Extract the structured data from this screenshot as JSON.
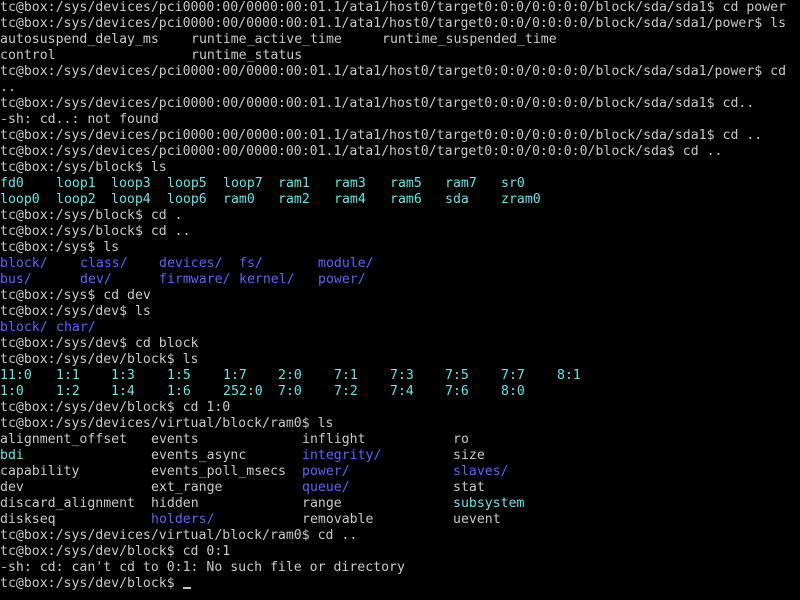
{
  "terminal": {
    "colors": {
      "background": "#000000",
      "text": "#c8c8c8",
      "directory": "#6060ff",
      "device": "#5ee8e8",
      "bold": "#ffffff"
    },
    "lines": [
      {
        "type": "text",
        "text": "tc@box:/sys/devices/pci0000:00/0000:00:01.1/ata1/host0/target0:0:0/0:0:0:0/block/sda/sda1$ cd power"
      },
      {
        "type": "text",
        "text": "tc@box:/sys/devices/pci0000:00/0000:00:01.1/ata1/host0/target0:0:0/0:0:0:0/block/sda/sda1/power$ ls"
      },
      {
        "type": "cols",
        "items": [
          {
            "text": "autosuspend_delay_ms",
            "color": "file"
          },
          {
            "text": "runtime_active_time",
            "color": "file"
          },
          {
            "text": "runtime_suspended_time",
            "color": "file"
          }
        ],
        "cols": [
          0,
          24,
          48
        ]
      },
      {
        "type": "cols",
        "items": [
          {
            "text": "control",
            "color": "file"
          },
          {
            "text": "runtime_status",
            "color": "file"
          }
        ],
        "cols": [
          0,
          24
        ]
      },
      {
        "type": "text",
        "text": "tc@box:/sys/devices/pci0000:00/0000:00:01.1/ata1/host0/target0:0:0/0:0:0:0/block/sda/sda1/power$ cd"
      },
      {
        "type": "text",
        "text": ".."
      },
      {
        "type": "text",
        "text": "tc@box:/sys/devices/pci0000:00/0000:00:01.1/ata1/host0/target0:0:0/0:0:0:0/block/sda/sda1$ cd.."
      },
      {
        "type": "text",
        "text": "-sh: cd..: not found"
      },
      {
        "type": "text",
        "text": "tc@box:/sys/devices/pci0000:00/0000:00:01.1/ata1/host0/target0:0:0/0:0:0:0/block/sda/sda1$ cd .."
      },
      {
        "type": "text",
        "text": "tc@box:/sys/devices/pci0000:00/0000:00:01.1/ata1/host0/target0:0:0/0:0:0:0/block/sda$ cd .."
      },
      {
        "type": "text",
        "text": "tc@box:/sys/block$ ls"
      },
      {
        "type": "cols",
        "items": [
          {
            "text": "fd0",
            "color": "cyan"
          },
          {
            "text": "loop1",
            "color": "cyan"
          },
          {
            "text": "loop3",
            "color": "cyan"
          },
          {
            "text": "loop5",
            "color": "cyan"
          },
          {
            "text": "loop7",
            "color": "cyan"
          },
          {
            "text": "ram1",
            "color": "cyan"
          },
          {
            "text": "ram3",
            "color": "cyan"
          },
          {
            "text": "ram5",
            "color": "cyan"
          },
          {
            "text": "ram7",
            "color": "cyan"
          },
          {
            "text": "sr0",
            "color": "cyan"
          }
        ],
        "cols": [
          0,
          7,
          14,
          21,
          28,
          35,
          42,
          49,
          56,
          63
        ]
      },
      {
        "type": "cols",
        "items": [
          {
            "text": "loop0",
            "color": "cyan"
          },
          {
            "text": "loop2",
            "color": "cyan"
          },
          {
            "text": "loop4",
            "color": "cyan"
          },
          {
            "text": "loop6",
            "color": "cyan"
          },
          {
            "text": "ram0",
            "color": "cyan"
          },
          {
            "text": "ram2",
            "color": "cyan"
          },
          {
            "text": "ram4",
            "color": "cyan"
          },
          {
            "text": "ram6",
            "color": "cyan"
          },
          {
            "text": "sda",
            "color": "cyan"
          },
          {
            "text": "zram0",
            "color": "cyan"
          }
        ],
        "cols": [
          0,
          7,
          14,
          21,
          28,
          35,
          42,
          49,
          56,
          63
        ]
      },
      {
        "type": "text",
        "text": "tc@box:/sys/block$ cd ."
      },
      {
        "type": "text",
        "text": "tc@box:/sys/block$ cd .."
      },
      {
        "type": "text",
        "text": "tc@box:/sys$ ls"
      },
      {
        "type": "cols",
        "items": [
          {
            "text": "block/",
            "color": "dir"
          },
          {
            "text": "class/",
            "color": "dir"
          },
          {
            "text": "devices/",
            "color": "dir"
          },
          {
            "text": "fs/",
            "color": "dir"
          },
          {
            "text": "module/",
            "color": "dir"
          }
        ],
        "cols": [
          0,
          10,
          20,
          30,
          40
        ]
      },
      {
        "type": "cols",
        "items": [
          {
            "text": "bus/",
            "color": "dir"
          },
          {
            "text": "dev/",
            "color": "dir"
          },
          {
            "text": "firmware/",
            "color": "dir"
          },
          {
            "text": "kernel/",
            "color": "dir"
          },
          {
            "text": "power/",
            "color": "dir"
          }
        ],
        "cols": [
          0,
          10,
          20,
          30,
          40
        ]
      },
      {
        "type": "text",
        "text": "tc@box:/sys$ cd dev"
      },
      {
        "type": "text",
        "text": "tc@box:/sys/dev$ ls"
      },
      {
        "type": "cols",
        "items": [
          {
            "text": "block/",
            "color": "dir"
          },
          {
            "text": "char/",
            "color": "dir"
          }
        ],
        "cols": [
          0,
          7
        ]
      },
      {
        "type": "text",
        "text": "tc@box:/sys/dev$ cd block"
      },
      {
        "type": "text",
        "text": "tc@box:/sys/dev/block$ ls"
      },
      {
        "type": "cols",
        "items": [
          {
            "text": "11:0",
            "color": "cyan"
          },
          {
            "text": "1:1",
            "color": "cyan"
          },
          {
            "text": "1:3",
            "color": "cyan"
          },
          {
            "text": "1:5",
            "color": "cyan"
          },
          {
            "text": "1:7",
            "color": "cyan"
          },
          {
            "text": "2:0",
            "color": "cyan"
          },
          {
            "text": "7:1",
            "color": "cyan"
          },
          {
            "text": "7:3",
            "color": "cyan"
          },
          {
            "text": "7:5",
            "color": "cyan"
          },
          {
            "text": "7:7",
            "color": "cyan"
          },
          {
            "text": "8:1",
            "color": "cyan"
          }
        ],
        "cols": [
          0,
          7,
          14,
          21,
          28,
          35,
          42,
          49,
          56,
          63,
          70
        ]
      },
      {
        "type": "cols",
        "items": [
          {
            "text": "1:0",
            "color": "cyan"
          },
          {
            "text": "1:2",
            "color": "cyan"
          },
          {
            "text": "1:4",
            "color": "cyan"
          },
          {
            "text": "1:6",
            "color": "cyan"
          },
          {
            "text": "252:0",
            "color": "cyan"
          },
          {
            "text": "7:0",
            "color": "cyan"
          },
          {
            "text": "7:2",
            "color": "cyan"
          },
          {
            "text": "7:4",
            "color": "cyan"
          },
          {
            "text": "7:6",
            "color": "cyan"
          },
          {
            "text": "8:0",
            "color": "cyan"
          }
        ],
        "cols": [
          0,
          7,
          14,
          21,
          28,
          35,
          42,
          49,
          56,
          63
        ]
      },
      {
        "type": "text",
        "text": "tc@box:/sys/dev/block$ cd 1:0"
      },
      {
        "type": "text",
        "text": "tc@box:/sys/devices/virtual/block/ram0$ ls"
      },
      {
        "type": "cols",
        "items": [
          {
            "text": "alignment_offset",
            "color": "file"
          },
          {
            "text": "events",
            "color": "file"
          },
          {
            "text": "inflight",
            "color": "file"
          },
          {
            "text": "ro",
            "color": "file"
          }
        ],
        "cols": [
          0,
          19,
          38,
          57
        ]
      },
      {
        "type": "cols",
        "items": [
          {
            "text": "bdi",
            "color": "cyan"
          },
          {
            "text": "events_async",
            "color": "file"
          },
          {
            "text": "integrity/",
            "color": "dir"
          },
          {
            "text": "size",
            "color": "file"
          }
        ],
        "cols": [
          0,
          19,
          38,
          57
        ]
      },
      {
        "type": "cols",
        "items": [
          {
            "text": "capability",
            "color": "file"
          },
          {
            "text": "events_poll_msecs",
            "color": "file"
          },
          {
            "text": "power/",
            "color": "dir"
          },
          {
            "text": "slaves/",
            "color": "dir"
          }
        ],
        "cols": [
          0,
          19,
          38,
          57
        ]
      },
      {
        "type": "cols",
        "items": [
          {
            "text": "dev",
            "color": "file"
          },
          {
            "text": "ext_range",
            "color": "file"
          },
          {
            "text": "queue/",
            "color": "dir"
          },
          {
            "text": "stat",
            "color": "file"
          }
        ],
        "cols": [
          0,
          19,
          38,
          57
        ]
      },
      {
        "type": "cols",
        "items": [
          {
            "text": "discard_alignment",
            "color": "file"
          },
          {
            "text": "hidden",
            "color": "file"
          },
          {
            "text": "range",
            "color": "file"
          },
          {
            "text": "subsystem",
            "color": "cyan"
          }
        ],
        "cols": [
          0,
          19,
          38,
          57
        ]
      },
      {
        "type": "cols",
        "items": [
          {
            "text": "diskseq",
            "color": "file"
          },
          {
            "text": "holders/",
            "color": "dir"
          },
          {
            "text": "removable",
            "color": "file"
          },
          {
            "text": "uevent",
            "color": "file"
          }
        ],
        "cols": [
          0,
          19,
          38,
          57
        ]
      },
      {
        "type": "text",
        "text": "tc@box:/sys/devices/virtual/block/ram0$ cd .."
      },
      {
        "type": "text",
        "text": "tc@box:/sys/dev/block$ cd 0:1"
      },
      {
        "type": "text",
        "text": "-sh: cd: can't cd to 0:1: No such file or directory"
      },
      {
        "type": "prompt",
        "text": "tc@box:/sys/dev/block$ "
      }
    ]
  }
}
